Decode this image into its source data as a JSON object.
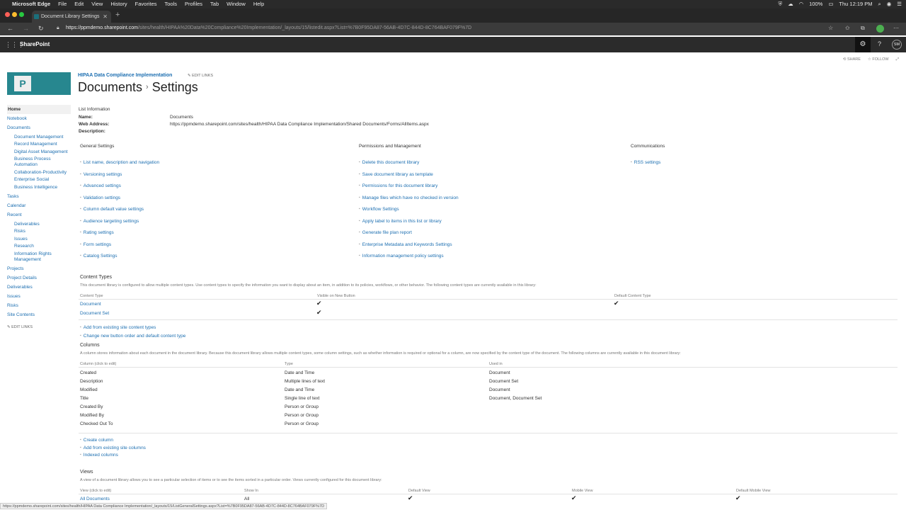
{
  "macbar": {
    "apple": "",
    "app": "Microsoft Edge",
    "menus": [
      "File",
      "Edit",
      "View",
      "History",
      "Favorites",
      "Tools",
      "Profiles",
      "Tab",
      "Window",
      "Help"
    ],
    "battery": "100%",
    "clock": "Thu 12:19 PM"
  },
  "tab": {
    "title": "Document Library Settings",
    "close": "✕",
    "new": "+"
  },
  "address": {
    "host": "https://ppmdemo.sharepoint.com",
    "path": "/sites/health/HIPAA%20Data%20Compliance%20Implementation/_layouts/15/listedit.aspx?List=%7B0F95DA87-56AB-4D7C-844D-8C764BAF079F%7D"
  },
  "suitebar": {
    "brand": "SharePoint",
    "initials": "SM"
  },
  "page_actions": {
    "share": "SHARE",
    "follow": "FOLLOW"
  },
  "site": {
    "title": "HIPAA Data Compliance Implementation",
    "edit_links": "EDIT LINKS"
  },
  "page_title": {
    "part1": "Documents",
    "part2": "Settings"
  },
  "leftnav": [
    {
      "label": "Home",
      "type": "home"
    },
    {
      "label": "Notebook",
      "type": "top"
    },
    {
      "label": "Documents",
      "type": "top"
    },
    {
      "label": "Document Management",
      "type": "sub"
    },
    {
      "label": "Record Management",
      "type": "sub"
    },
    {
      "label": "Digital Asset Management",
      "type": "sub"
    },
    {
      "label": "Business Process Automation",
      "type": "sub"
    },
    {
      "label": "Collaboration-Productivity",
      "type": "sub"
    },
    {
      "label": "Enterprise Social",
      "type": "sub"
    },
    {
      "label": "Business Intelligence",
      "type": "sub"
    },
    {
      "label": "Tasks",
      "type": "top"
    },
    {
      "label": "Calendar",
      "type": "top"
    },
    {
      "label": "Recent",
      "type": "top"
    },
    {
      "label": "Deliverables",
      "type": "sub"
    },
    {
      "label": "Risks",
      "type": "sub"
    },
    {
      "label": "Issues",
      "type": "sub"
    },
    {
      "label": "Research",
      "type": "sub"
    },
    {
      "label": "Information Rights Management",
      "type": "sub"
    },
    {
      "label": "Projects",
      "type": "top"
    },
    {
      "label": "Project Details",
      "type": "top"
    },
    {
      "label": "Deliverables",
      "type": "top"
    },
    {
      "label": "Issues",
      "type": "top"
    },
    {
      "label": "Risks",
      "type": "top"
    },
    {
      "label": "Site Contents",
      "type": "top"
    }
  ],
  "list_info": {
    "heading": "List Information",
    "name_label": "Name:",
    "name": "Documents",
    "web_label": "Web Address:",
    "web": "https://ppmdemo.sharepoint.com/sites/health/HIPAA Data Compliance Implementation/Shared Documents/Forms/AllItems.aspx",
    "desc_label": "Description:"
  },
  "general": {
    "heading": "General Settings",
    "links": [
      "List name, description and navigation",
      "Versioning settings",
      "Advanced settings",
      "Validation settings",
      "Column default value settings",
      "Audience targeting settings",
      "Rating settings",
      "Form settings",
      "Catalog Settings"
    ]
  },
  "permissions": {
    "heading": "Permissions and Management",
    "links": [
      "Delete this document library",
      "Save document library as template",
      "Permissions for this document library",
      "Manage files which have no checked in version",
      "Workflow Settings",
      "Apply label to items in this list or library",
      "Generate file plan report",
      "Enterprise Metadata and Keywords Settings",
      "Information management policy settings"
    ]
  },
  "communications": {
    "heading": "Communications",
    "links": [
      "RSS settings"
    ]
  },
  "content_types": {
    "heading": "Content Types",
    "desc": "This document library is configured to allow multiple content types. Use content types to specify the information you want to display about an item, in addition to its policies, workflows, or other behavior. The following content types are currently available in this library:",
    "col1": "Content Type",
    "col2": "Visible on New Button",
    "col3": "Default Content Type",
    "rows": [
      {
        "name": "Document",
        "visible": "✔",
        "default": "✔"
      },
      {
        "name": "Document Set",
        "visible": "✔",
        "default": ""
      }
    ],
    "links": [
      "Add from existing site content types",
      "Change new button order and default content type"
    ]
  },
  "columns": {
    "heading": "Columns",
    "desc": "A column stores information about each document in the document library. Because this document library allows multiple content types, some column settings, such as whether information is required or optional for a column, are now specified by the content type of the document. The following columns are currently available in this document library:",
    "col1": "Column (click to edit)",
    "col2": "Type",
    "col3": "Used in",
    "rows": [
      {
        "name": "Created",
        "type": "Date and Time",
        "used": "Document"
      },
      {
        "name": "Description",
        "type": "Multiple lines of text",
        "used": "Document Set"
      },
      {
        "name": "Modified",
        "type": "Date and Time",
        "used": "Document"
      },
      {
        "name": "Title",
        "type": "Single line of text",
        "used": "Document, Document Set"
      },
      {
        "name": "Created By",
        "type": "Person or Group",
        "used": ""
      },
      {
        "name": "Modified By",
        "type": "Person or Group",
        "used": ""
      },
      {
        "name": "Checked Out To",
        "type": "Person or Group",
        "used": ""
      }
    ],
    "links": [
      "Create column",
      "Add from existing site columns",
      "Indexed columns"
    ]
  },
  "views": {
    "heading": "Views",
    "desc": "A view of a document library allows you to see a particular selection of items or to see the items sorted in a particular order. Views currently configured for this document library:",
    "cols": [
      "View (click to edit)",
      "Show In",
      "Default View",
      "Mobile View",
      "Default Mobile View"
    ],
    "row": {
      "name": "All Documents",
      "show": "All",
      "default": "✔",
      "mobile": "✔",
      "default_mobile": "✔"
    }
  },
  "statusbar": "https://ppmdemo.sharepoint.com/sites/health/HIPAA Data Compliance Implementation/_layouts/15/ListGeneralSettings.aspx?List=%7B0F95DA87-56AB-4D7C-844D-8C764BAF079F%7D"
}
